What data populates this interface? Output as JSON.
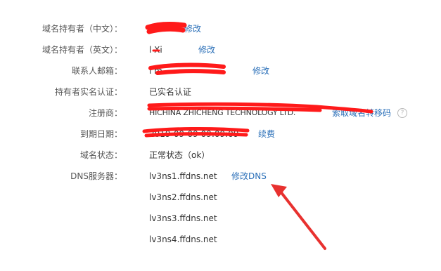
{
  "rows": [
    {
      "label": "域名持有者（中文）：",
      "value": "",
      "link": "修改"
    },
    {
      "label": "域名持有者（英文）：",
      "value": "l     Xi",
      "link": "修改"
    },
    {
      "label": "联系人邮箱：",
      "value": "l                               m",
      "link": "修改"
    },
    {
      "label": "持有者实名认证：",
      "value": "已实名认证"
    },
    {
      "label": "注册商：",
      "value": "HICHINA ZHICHENG TECHNOLOGY LTD.",
      "link": "索取域名转移码",
      "help_icon": "question-circle-icon"
    },
    {
      "label": "到期日期：",
      "value": "2019-09-09 09:09:09",
      "link": "续费"
    },
    {
      "label": "域名状态：",
      "value": "正常状态（ok）"
    },
    {
      "label": "DNS服务器：",
      "value": "lv3ns1.ffdns.net",
      "link": "修改DNS"
    }
  ],
  "dns_servers": [
    "lv3ns2.ffdns.net",
    "lv3ns3.ffdns.net",
    "lv3ns4.ffdns.net"
  ],
  "colors": {
    "link": "#2a6fb8",
    "label": "#555555",
    "redaction": "#ff1a1a",
    "arrow": "#e8312f"
  }
}
